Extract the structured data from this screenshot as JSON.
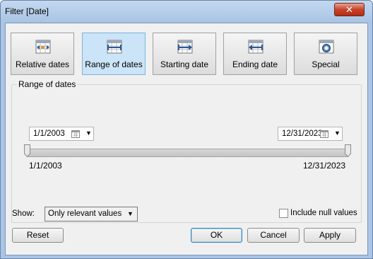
{
  "window": {
    "title": "Filter [Date]",
    "close_glyph": "✕"
  },
  "modes": [
    {
      "label": "Relative dates",
      "icon": "relative-dates-icon",
      "active": false
    },
    {
      "label": "Range of dates",
      "icon": "range-of-dates-icon",
      "active": true
    },
    {
      "label": "Starting date",
      "icon": "starting-date-icon",
      "active": false
    },
    {
      "label": "Ending date",
      "icon": "ending-date-icon",
      "active": false
    },
    {
      "label": "Special",
      "icon": "special-icon",
      "active": false
    }
  ],
  "range": {
    "group_label": "Range of dates",
    "start_input": "1/1/2003",
    "end_input": "12/31/2023",
    "min_label": "1/1/2003",
    "max_label": "12/31/2023"
  },
  "show": {
    "label": "Show:",
    "selected": "Only relevant values"
  },
  "include_null": {
    "label": "Include null values",
    "checked": false
  },
  "buttons": {
    "reset": "Reset",
    "ok": "OK",
    "cancel": "Cancel",
    "apply": "Apply"
  },
  "colors": {
    "active_mode_bg": "#cce4f7",
    "frame": "#a9c4e4",
    "close": "#c7432b"
  }
}
